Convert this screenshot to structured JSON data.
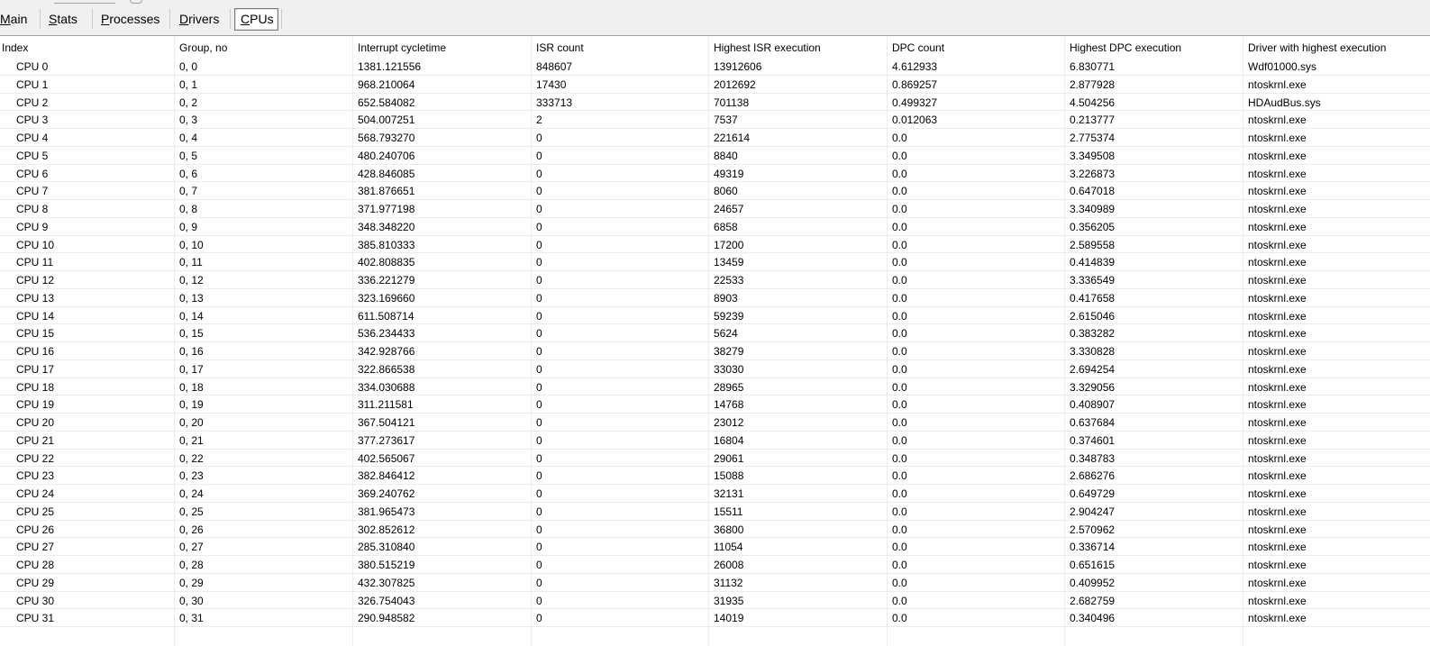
{
  "tabs": [
    {
      "pre": "",
      "key": "M",
      "post": "ain",
      "selected": false
    },
    {
      "pre": "",
      "key": "S",
      "post": "tats",
      "selected": false
    },
    {
      "pre": "",
      "key": "P",
      "post": "rocesses",
      "selected": false
    },
    {
      "pre": "",
      "key": "D",
      "post": "rivers",
      "selected": false
    },
    {
      "pre": "",
      "key": "C",
      "post": "PUs",
      "selected": true
    }
  ],
  "table": {
    "columns": [
      "Index",
      "Group, no",
      "Interrupt cycletime",
      "ISR count",
      "Highest ISR execution",
      "DPC count",
      "Highest DPC execution",
      "Driver with highest execution"
    ],
    "rows": [
      [
        "CPU 0",
        "0, 0",
        "1381.121556",
        "848607",
        "13912606",
        "4.612933",
        "6.830771",
        "Wdf01000.sys"
      ],
      [
        "CPU 1",
        "0, 1",
        "968.210064",
        "17430",
        "2012692",
        "0.869257",
        "2.877928",
        "ntoskrnl.exe"
      ],
      [
        "CPU 2",
        "0, 2",
        "652.584082",
        "333713",
        "701138",
        "0.499327",
        "4.504256",
        "HDAudBus.sys"
      ],
      [
        "CPU 3",
        "0, 3",
        "504.007251",
        "2",
        "7537",
        "0.012063",
        "0.213777",
        "ntoskrnl.exe"
      ],
      [
        "CPU 4",
        "0, 4",
        "568.793270",
        "0",
        "221614",
        "0.0",
        "2.775374",
        "ntoskrnl.exe"
      ],
      [
        "CPU 5",
        "0, 5",
        "480.240706",
        "0",
        "8840",
        "0.0",
        "3.349508",
        "ntoskrnl.exe"
      ],
      [
        "CPU 6",
        "0, 6",
        "428.846085",
        "0",
        "49319",
        "0.0",
        "3.226873",
        "ntoskrnl.exe"
      ],
      [
        "CPU 7",
        "0, 7",
        "381.876651",
        "0",
        "8060",
        "0.0",
        "0.647018",
        "ntoskrnl.exe"
      ],
      [
        "CPU 8",
        "0, 8",
        "371.977198",
        "0",
        "24657",
        "0.0",
        "3.340989",
        "ntoskrnl.exe"
      ],
      [
        "CPU 9",
        "0, 9",
        "348.348220",
        "0",
        "6858",
        "0.0",
        "0.356205",
        "ntoskrnl.exe"
      ],
      [
        "CPU 10",
        "0, 10",
        "385.810333",
        "0",
        "17200",
        "0.0",
        "2.589558",
        "ntoskrnl.exe"
      ],
      [
        "CPU 11",
        "0, 11",
        "402.808835",
        "0",
        "13459",
        "0.0",
        "0.414839",
        "ntoskrnl.exe"
      ],
      [
        "CPU 12",
        "0, 12",
        "336.221279",
        "0",
        "22533",
        "0.0",
        "3.336549",
        "ntoskrnl.exe"
      ],
      [
        "CPU 13",
        "0, 13",
        "323.169660",
        "0",
        "8903",
        "0.0",
        "0.417658",
        "ntoskrnl.exe"
      ],
      [
        "CPU 14",
        "0, 14",
        "611.508714",
        "0",
        "59239",
        "0.0",
        "2.615046",
        "ntoskrnl.exe"
      ],
      [
        "CPU 15",
        "0, 15",
        "536.234433",
        "0",
        "5624",
        "0.0",
        "0.383282",
        "ntoskrnl.exe"
      ],
      [
        "CPU 16",
        "0, 16",
        "342.928766",
        "0",
        "38279",
        "0.0",
        "3.330828",
        "ntoskrnl.exe"
      ],
      [
        "CPU 17",
        "0, 17",
        "322.866538",
        "0",
        "33030",
        "0.0",
        "2.694254",
        "ntoskrnl.exe"
      ],
      [
        "CPU 18",
        "0, 18",
        "334.030688",
        "0",
        "28965",
        "0.0",
        "3.329056",
        "ntoskrnl.exe"
      ],
      [
        "CPU 19",
        "0, 19",
        "311.211581",
        "0",
        "14768",
        "0.0",
        "0.408907",
        "ntoskrnl.exe"
      ],
      [
        "CPU 20",
        "0, 20",
        "367.504121",
        "0",
        "23012",
        "0.0",
        "0.637684",
        "ntoskrnl.exe"
      ],
      [
        "CPU 21",
        "0, 21",
        "377.273617",
        "0",
        "16804",
        "0.0",
        "0.374601",
        "ntoskrnl.exe"
      ],
      [
        "CPU 22",
        "0, 22",
        "402.565067",
        "0",
        "29061",
        "0.0",
        "0.348783",
        "ntoskrnl.exe"
      ],
      [
        "CPU 23",
        "0, 23",
        "382.846412",
        "0",
        "15088",
        "0.0",
        "2.686276",
        "ntoskrnl.exe"
      ],
      [
        "CPU 24",
        "0, 24",
        "369.240762",
        "0",
        "32131",
        "0.0",
        "0.649729",
        "ntoskrnl.exe"
      ],
      [
        "CPU 25",
        "0, 25",
        "381.965473",
        "0",
        "15511",
        "0.0",
        "2.904247",
        "ntoskrnl.exe"
      ],
      [
        "CPU 26",
        "0, 26",
        "302.852612",
        "0",
        "36800",
        "0.0",
        "2.570962",
        "ntoskrnl.exe"
      ],
      [
        "CPU 27",
        "0, 27",
        "285.310840",
        "0",
        "11054",
        "0.0",
        "0.336714",
        "ntoskrnl.exe"
      ],
      [
        "CPU 28",
        "0, 28",
        "380.515219",
        "0",
        "26008",
        "0.0",
        "0.651615",
        "ntoskrnl.exe"
      ],
      [
        "CPU 29",
        "0, 29",
        "432.307825",
        "0",
        "31132",
        "0.0",
        "0.409952",
        "ntoskrnl.exe"
      ],
      [
        "CPU 30",
        "0, 30",
        "326.754043",
        "0",
        "31935",
        "0.0",
        "2.682759",
        "ntoskrnl.exe"
      ],
      [
        "CPU 31",
        "0, 31",
        "290.948582",
        "0",
        "14019",
        "0.0",
        "0.340496",
        "ntoskrnl.exe"
      ]
    ]
  },
  "colors": {
    "tab_bar": "#f0f0f0",
    "grid": "#ececec",
    "selected_tab_border": "#7a7a7a"
  }
}
